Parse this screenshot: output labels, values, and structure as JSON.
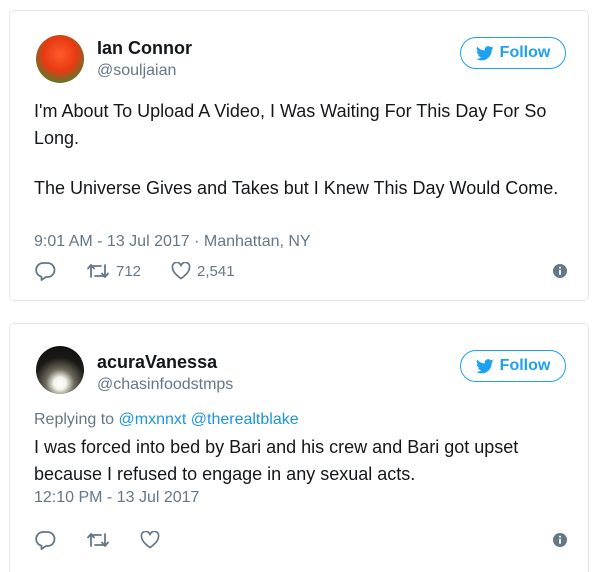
{
  "colors": {
    "accent": "#1da1f2",
    "mention": "#1b95e0",
    "text": "#14171a",
    "secondary": "#657786",
    "border": "#e1e8ed"
  },
  "tweets": [
    {
      "author": {
        "name": "Ian Connor",
        "handle": "@souljaian"
      },
      "follow_label": "Follow",
      "paragraphs": [
        "I'm About To Upload A Video, I Was Waiting For This Day For So Long.",
        "The Universe Gives and Takes but I Knew This Day Would Come."
      ],
      "timestamp": "9:01 AM - 13 Jul 2017 · Manhattan, NY",
      "retweets": "712",
      "likes": "2,541",
      "icons": [
        "reply-icon",
        "retweet-icon",
        "heart-icon",
        "info-icon"
      ]
    },
    {
      "author": {
        "name": "acuraVanessa",
        "handle": "@chasinfoodstmps"
      },
      "follow_label": "Follow",
      "reply_to": {
        "prefix": "Replying to",
        "mentions": [
          "@mxnnxt",
          "@therealtblake"
        ]
      },
      "text": "I was forced into bed by Bari and his crew and Bari got upset because I refused to engage in any sexual acts.",
      "timestamp": "12:10 PM - 13 Jul 2017",
      "icons": [
        "reply-icon",
        "retweet-icon",
        "heart-icon",
        "info-icon"
      ]
    }
  ]
}
